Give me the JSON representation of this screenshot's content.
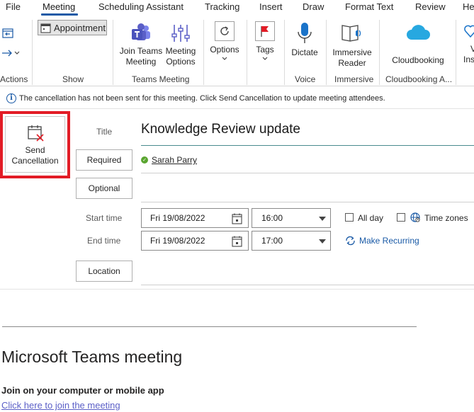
{
  "tabs": [
    {
      "label": "File",
      "active": false
    },
    {
      "label": "Meeting",
      "active": true
    },
    {
      "label": "Scheduling Assistant",
      "active": false
    },
    {
      "label": "Tracking",
      "active": false
    },
    {
      "label": "Insert",
      "active": false
    },
    {
      "label": "Draw",
      "active": false
    },
    {
      "label": "Format Text",
      "active": false
    },
    {
      "label": "Review",
      "active": false
    },
    {
      "label": "He",
      "active": false
    }
  ],
  "ribbon": {
    "groups": {
      "actions": "Actions",
      "show": "Show",
      "teams_meeting": "Teams Meeting",
      "voice": "Voice",
      "immersive": "Immersive",
      "cloudbooking": "Cloudbooking A..."
    },
    "appointment": "Appointment",
    "join_teams_l1": "Join Teams",
    "join_teams_l2": "Meeting",
    "meeting_options_l1": "Meeting",
    "meeting_options_l2": "Options",
    "options": "Options",
    "tags": "Tags",
    "dictate": "Dictate",
    "immersive_l1": "Immersive",
    "immersive_l2": "Reader",
    "cloudbooking": "Cloudbooking",
    "partial_l1": "V",
    "partial_l2": "Ins"
  },
  "info_message": "The cancellation has not been sent for this meeting. Click Send Cancellation to update meeting attendees.",
  "send_cancellation_l1": "Send",
  "send_cancellation_l2": "Cancellation",
  "form": {
    "title_label": "Title",
    "title_value": "Knowledge Review update",
    "required_label": "Required",
    "required_attendee": "Sarah Parry",
    "optional_label": "Optional",
    "start_label": "Start time",
    "start_date": "Fri 19/08/2022",
    "start_time": "16:00",
    "end_label": "End time",
    "end_date": "Fri 19/08/2022",
    "end_time": "17:00",
    "all_day": "All day",
    "time_zones": "Time zones",
    "make_recurring": "Make Recurring",
    "location_label": "Location"
  },
  "body": {
    "teams_title": "Microsoft Teams meeting",
    "join_subtitle": "Join on your computer or mobile app",
    "join_link": "Click here to join the meeting"
  },
  "colors": {
    "accent": "#1a5aa6",
    "highlight": "#e21c26",
    "teams_purple": "#5b5fc7"
  }
}
